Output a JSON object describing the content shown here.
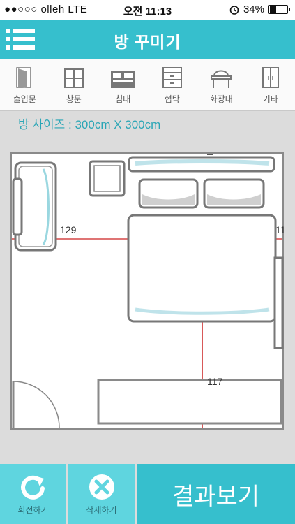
{
  "status": {
    "carrier": "●●○○○ olleh  LTE",
    "time": "오전 11:13",
    "battery": "34%",
    "battery_level": 0.34
  },
  "header": {
    "title": "방 꾸미기"
  },
  "tools": [
    {
      "label": "출입문",
      "icon": "door-icon"
    },
    {
      "label": "창문",
      "icon": "window-icon"
    },
    {
      "label": "침대",
      "icon": "bed-icon"
    },
    {
      "label": "협탁",
      "icon": "nightstand-icon"
    },
    {
      "label": "화장대",
      "icon": "vanity-icon"
    },
    {
      "label": "기타",
      "icon": "wardrobe-icon"
    }
  ],
  "room": {
    "size_label": "방 사이즈 : 300cm X 300cm",
    "dimensions": {
      "left_gap": "129",
      "bottom_gap": "117",
      "right_gap": "11"
    }
  },
  "actions": {
    "rotate": "회전하기",
    "delete": "삭제하기",
    "result": "결과보기"
  },
  "colors": {
    "accent": "#36bfcd",
    "light_accent": "#5fd5df",
    "guide_line": "#cc2222"
  }
}
